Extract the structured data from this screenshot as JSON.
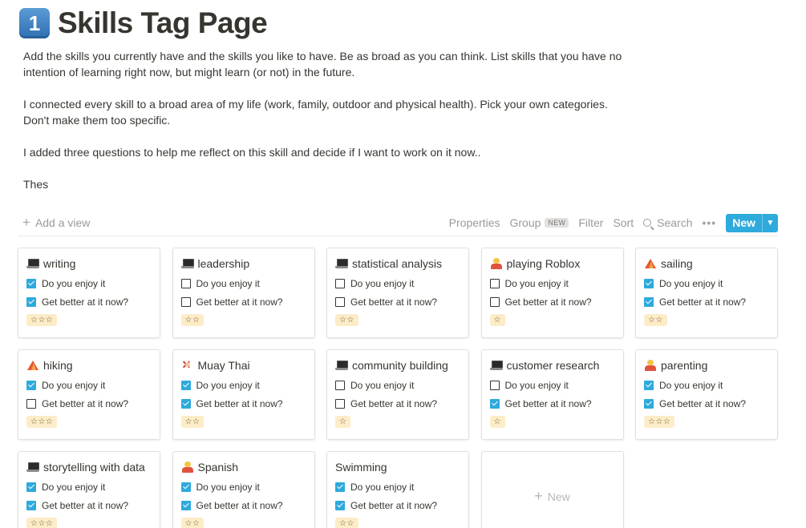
{
  "page": {
    "emoji": "1",
    "title": "Skills Tag Page",
    "paragraphs": [
      "Add the skills you currently have and the skills you like to have. Be as broad as you can think. List skills that you have no intention of learning right now, but might learn (or not) in the future.",
      "I connected every skill to a broad area of my life (work, family, outdoor and physical health). Pick your own categories. Don't make them too specific.",
      "I added three questions to help me reflect on this skill and decide if I want to work on it now..",
      "Thes"
    ]
  },
  "toolbar": {
    "add_view": "Add a view",
    "properties": "Properties",
    "group": "Group",
    "group_badge": "NEW",
    "filter": "Filter",
    "sort": "Sort",
    "search": "Search",
    "more": "•••",
    "new": "New"
  },
  "cards": [
    {
      "icon": "laptop-icon",
      "title": "writing",
      "enjoy": true,
      "better": true,
      "stars": "☆☆☆"
    },
    {
      "icon": "laptop-icon",
      "title": "leadership",
      "enjoy": false,
      "better": false,
      "stars": "☆☆"
    },
    {
      "icon": "laptop-icon",
      "title": "statistical analysis",
      "enjoy": false,
      "better": false,
      "stars": "☆☆"
    },
    {
      "icon": "person-icon",
      "title": "playing Roblox",
      "enjoy": false,
      "better": false,
      "stars": "☆"
    },
    {
      "icon": "mountain-icon",
      "title": "sailing",
      "enjoy": true,
      "better": true,
      "stars": "☆☆"
    },
    {
      "icon": "mountain-icon",
      "title": "hiking",
      "enjoy": true,
      "better": false,
      "stars": "☆☆☆"
    },
    {
      "icon": "fighter-icon",
      "title": "Muay Thai",
      "enjoy": true,
      "better": true,
      "stars": "☆☆"
    },
    {
      "icon": "laptop-icon",
      "title": "community building",
      "enjoy": false,
      "better": false,
      "stars": "☆"
    },
    {
      "icon": "laptop-icon",
      "title": "customer research",
      "enjoy": false,
      "better": true,
      "stars": "☆"
    },
    {
      "icon": "person-icon",
      "title": "parenting",
      "enjoy": true,
      "better": true,
      "stars": "☆☆☆"
    },
    {
      "icon": "laptop-icon",
      "title": "storytelling with data",
      "enjoy": true,
      "better": true,
      "stars": "☆☆☆"
    },
    {
      "icon": "person-icon",
      "title": "Spanish",
      "enjoy": true,
      "better": true,
      "stars": "☆☆"
    },
    {
      "icon": "",
      "title": "Swimming",
      "enjoy": true,
      "better": true,
      "stars": "☆☆"
    }
  ],
  "card_labels": {
    "enjoy": "Do you enjoy it",
    "better": "Get better at it now?"
  },
  "new_card": "New",
  "colors": {
    "accent": "#2eaadc",
    "star_tag_bg": "#fdecc8"
  }
}
